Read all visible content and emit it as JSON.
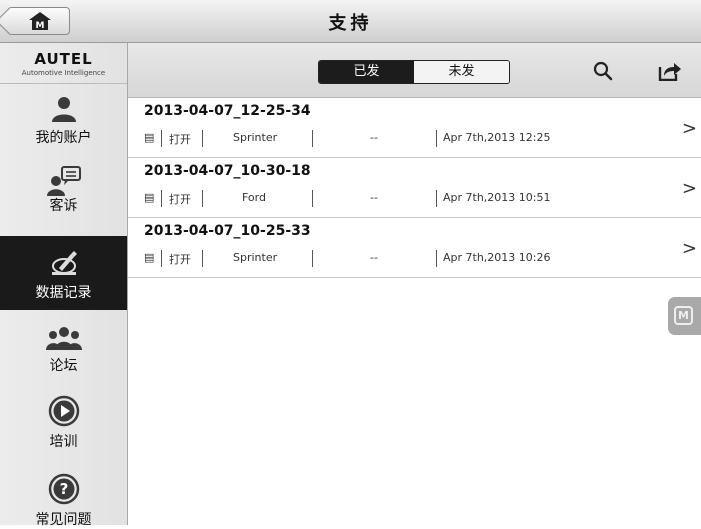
{
  "header": {
    "title": "支持",
    "home_icon": "home-icon"
  },
  "brand": {
    "name": "AUTEL",
    "tagline": "Automotive Intelligence"
  },
  "sidebar": {
    "items": [
      {
        "label": "我的账户",
        "icon": "account-icon"
      },
      {
        "label": "客诉",
        "icon": "complaint-icon"
      },
      {
        "label": "数据记录",
        "icon": "data-log-icon",
        "active": true
      },
      {
        "label": "论坛",
        "icon": "forum-icon"
      },
      {
        "label": "培训",
        "icon": "play-icon"
      },
      {
        "label": "常见问题",
        "icon": "help-icon"
      }
    ]
  },
  "toolbar": {
    "tab_sent": "已发",
    "tab_unsent": "未发",
    "search_icon": "search-icon",
    "share_icon": "share-icon"
  },
  "records": [
    {
      "title": "2013-04-07_12-25-34",
      "action": "打开",
      "vehicle": "Sprinter",
      "status": "--",
      "time": "Apr 7th,2013 12:25"
    },
    {
      "title": "2013-04-07_10-30-18",
      "action": "打开",
      "vehicle": "Ford",
      "status": "--",
      "time": "Apr 7th,2013 10:51"
    },
    {
      "title": "2013-04-07_10-25-33",
      "action": "打开",
      "vehicle": "Sprinter",
      "status": "--",
      "time": "Apr 7th,2013 10:26"
    }
  ],
  "floating_button": {
    "label": "M"
  }
}
